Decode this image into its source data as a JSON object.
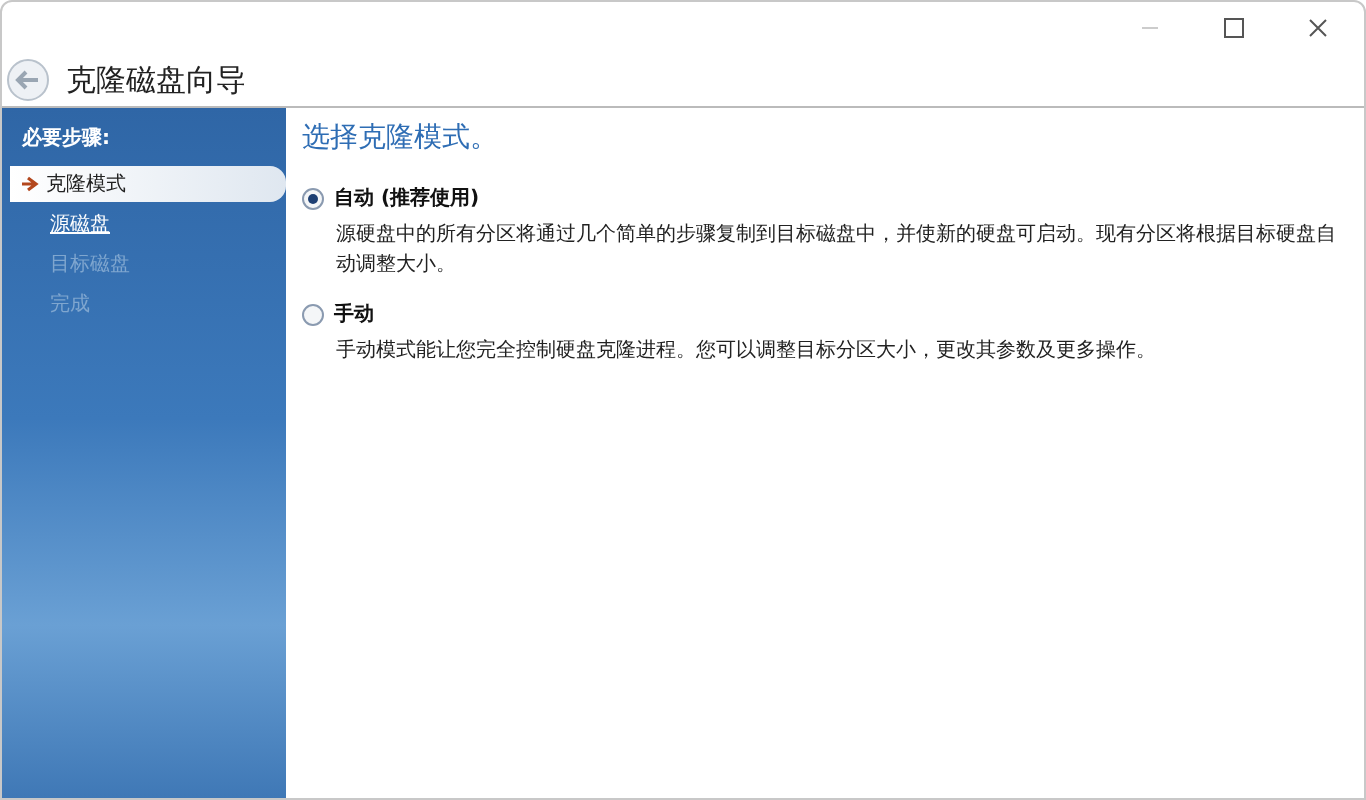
{
  "window": {
    "title": "克隆磁盘向导"
  },
  "sidebar": {
    "heading": "必要步骤:",
    "items": [
      {
        "label": "克隆模式",
        "selected": true,
        "disabled": false
      },
      {
        "label": "源磁盘",
        "selected": false,
        "disabled": false
      },
      {
        "label": "目标磁盘",
        "selected": false,
        "disabled": true
      },
      {
        "label": "完成",
        "selected": false,
        "disabled": true
      }
    ]
  },
  "content": {
    "heading": "选择克隆模式。",
    "options": [
      {
        "label": "自动 (推荐使用)",
        "selected": true,
        "description": "源硬盘中的所有分区将通过几个简单的步骤复制到目标磁盘中，并使新的硬盘可启动。现有分区将根据目标硬盘自动调整大小。"
      },
      {
        "label": "手动",
        "selected": false,
        "description": "手动模式能让您完全控制硬盘克隆进程。您可以调整目标分区大小，更改其参数及更多操作。"
      }
    ]
  }
}
